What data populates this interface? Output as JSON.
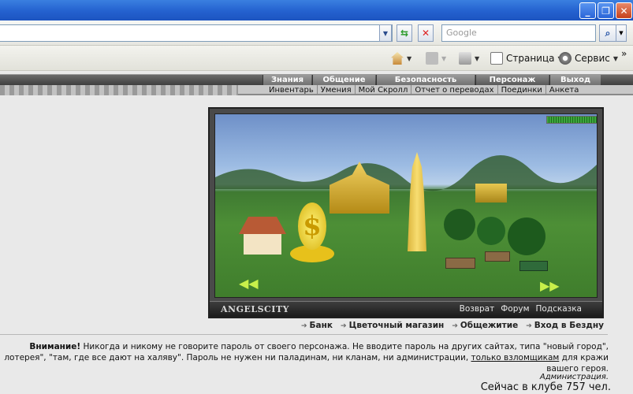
{
  "window": {
    "minimize": "_",
    "restore": "❐",
    "close": "✕"
  },
  "addressbar": {
    "search_placeholder": "Google"
  },
  "commandbar": {
    "page_label": "Страница",
    "tools_label": "Сервис",
    "more": "»"
  },
  "game_nav": {
    "top": [
      "Знания",
      "Общение",
      "Безопасность",
      "Персонаж",
      "Выход"
    ],
    "sub": [
      "Инвентарь",
      "Умения",
      "Мой Скролл",
      "Отчет о переводах",
      "Поединки",
      "Анкета"
    ]
  },
  "frame": {
    "brand": "ANGELSCITY",
    "links": [
      "Возврат",
      "Форум",
      "Подсказка"
    ]
  },
  "locations": [
    "Банк",
    "Цветочный магазин",
    "Общежитие",
    "Вход в Бездну"
  ],
  "warning": {
    "bold": "Внимание!",
    "line1": " Никогда и никому не говорите пароль от своего персонажа. Не вводите пароль на других сайтах, типа \"новый город\",",
    "line2": "лотерея\", \"там, где все дают на халяву\". Пароль не нужен ни паладинам, ни кланам, ни администрации,",
    "link": "только взломщикам",
    "line2b": " для кражи",
    "line3": "вашего героя.",
    "admin": "Администрация."
  },
  "online": "Сейчас в клубе 757 чел.",
  "colors": {
    "titlebar": "#2461cf",
    "nav_tab": "#7a7a7a",
    "frame": "#4a4a4a"
  }
}
